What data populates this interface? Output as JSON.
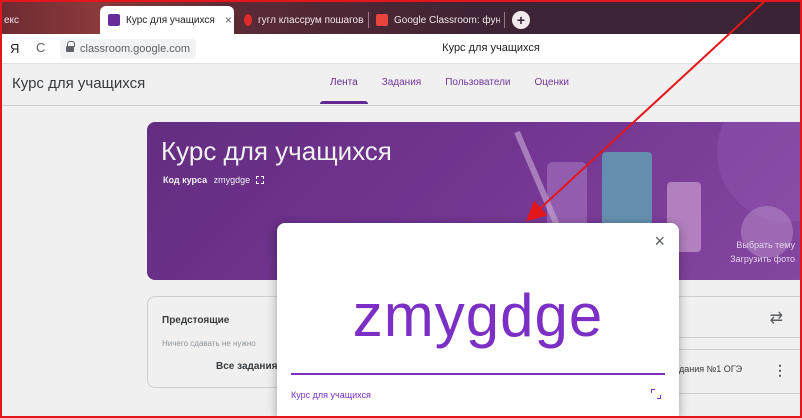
{
  "browser": {
    "tabs": [
      {
        "label": "екс",
        "favicon_color": "#f0c000"
      },
      {
        "label": "Курс для учащихся",
        "favicon_color": "#6b2c9b",
        "active": true
      },
      {
        "label": "гугл классрум пошаговая",
        "favicon_color": "#e22929"
      },
      {
        "label": "Google Classroom: функц",
        "favicon_color": "#e8453c"
      }
    ],
    "close_glyph": "×",
    "new_tab_glyph": "+",
    "yandex_glyph": "Я",
    "reload_glyph": "C",
    "url": "classroom.google.com",
    "page_title": "Курс для учащихся"
  },
  "header": {
    "course_title": "Курс для учащихся",
    "tabs": [
      "Лента",
      "Задания",
      "Пользователи",
      "Оценки"
    ],
    "active_tab": "Лента"
  },
  "banner": {
    "title": "Курс для учащихся",
    "code_label": "Код курса",
    "code": "zmygdge",
    "select_theme": "Выбрать тему",
    "upload_photo": "Загрузить фото"
  },
  "upcoming": {
    "title": "Предстоящие",
    "empty": "Ничего сдавать не нужно",
    "all_link": "Все задания"
  },
  "stream": {
    "item_text": "дания №1 ОГЭ"
  },
  "modal": {
    "code": "zmygdge",
    "course_name": "Курс для учащихся",
    "close_glyph": "×"
  },
  "colors": {
    "accent": "#6b2c9b",
    "code_color": "#7b2fc4",
    "annotation_red": "#e3161b"
  },
  "icons": [
    "close-icon",
    "fullscreen-icon",
    "swap-icon",
    "more-vert-icon",
    "lock-icon",
    "reload-icon"
  ]
}
